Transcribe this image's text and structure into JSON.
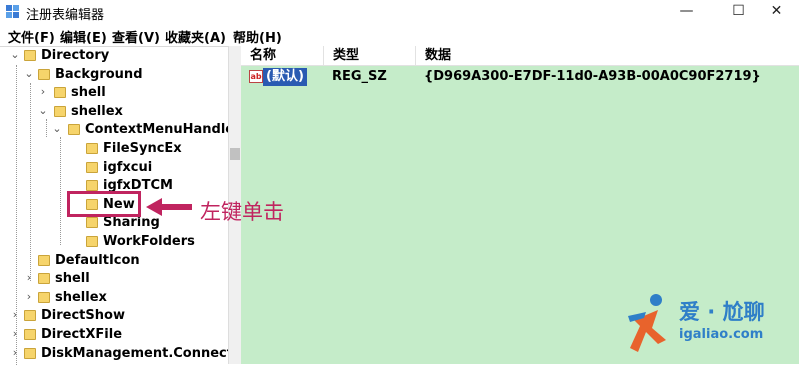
{
  "window": {
    "title": "注册表编辑器",
    "controls": [
      "—",
      "☐",
      "✕"
    ]
  },
  "menu": [
    "文件(F)",
    "编辑(E)",
    "查看(V)",
    "收藏夹(A)",
    "帮助(H)"
  ],
  "tree": [
    {
      "label": "Directory",
      "expander": "⌄"
    },
    {
      "label": "Background",
      "expander": "⌄"
    },
    {
      "label": "shell",
      "expander": "›"
    },
    {
      "label": "shellex",
      "expander": "⌄"
    },
    {
      "label": "ContextMenuHandlers",
      "expander": "⌄"
    },
    {
      "label": "FileSyncEx",
      "expander": ""
    },
    {
      "label": "igfxcui",
      "expander": ""
    },
    {
      "label": "igfxDTCM",
      "expander": ""
    },
    {
      "label": "New",
      "expander": ""
    },
    {
      "label": "Sharing",
      "expander": ""
    },
    {
      "label": "WorkFolders",
      "expander": ""
    },
    {
      "label": "DefaultIcon",
      "expander": ""
    },
    {
      "label": "shell",
      "expander": "›"
    },
    {
      "label": "shellex",
      "expander": "›"
    },
    {
      "label": "DirectShow",
      "expander": "›"
    },
    {
      "label": "DirectXFile",
      "expander": "›"
    },
    {
      "label": "DiskManagement.Connection",
      "expander": "›"
    }
  ],
  "columns": {
    "name": "名称",
    "type": "类型",
    "data": "数据"
  },
  "values": [
    {
      "name": "(默认)",
      "type": "REG_SZ",
      "data": "{D969A300-E7DF-11d0-A93B-00A0C90F2719}"
    }
  ],
  "annotation": {
    "text": "左键单击",
    "color": "#c0245f"
  },
  "watermark": {
    "name": "爱 · 尬聊",
    "site": "igaliao.com"
  },
  "colors": {
    "value_pane": "#c5ecc9",
    "selection": "#2a5bb2",
    "folder": "#f6d46b"
  }
}
